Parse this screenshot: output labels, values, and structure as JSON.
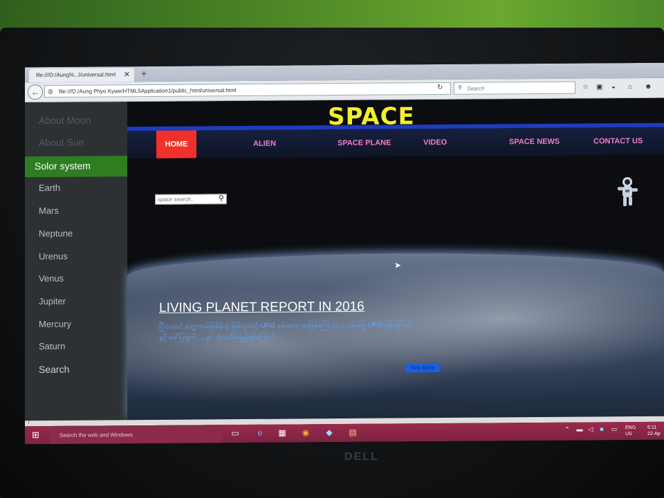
{
  "browser": {
    "tab_title": "file:///D:/Aung%...l/universal.html",
    "url": "file:///D:/Aung Phyo Kywe/HTML5Application1/public_html/universal.html",
    "search_placeholder": "Search"
  },
  "sidebar": {
    "items": [
      {
        "label": "About Moon"
      },
      {
        "label": "About Sun"
      },
      {
        "label": "Solor system"
      },
      {
        "label": "Earth"
      },
      {
        "label": "Mars"
      },
      {
        "label": "Neptune"
      },
      {
        "label": "Urenus"
      },
      {
        "label": "Venus"
      },
      {
        "label": "Jupiter"
      },
      {
        "label": "Mercury"
      },
      {
        "label": "Saturn"
      },
      {
        "label": "Search"
      }
    ]
  },
  "header": {
    "logo": "SPACE"
  },
  "menu": {
    "items": [
      {
        "label": "HOME"
      },
      {
        "label": "ALIEN"
      },
      {
        "label": "SPACE PLANE"
      },
      {
        "label": "VIDEO"
      },
      {
        "label": "SPACE NEWS"
      },
      {
        "label": "CONTACT US"
      }
    ],
    "active_color": "#f0302a"
  },
  "search": {
    "placeholder": "space search.."
  },
  "article": {
    "title": "LIVING PLANET REPORT IN 2016",
    "body": "ပြီးလသင် တွေ့ဘဝမ်ဖြစ်ခဲ့တဲ့ ဖြစ်သွားတဲ့ UFO ဖမ်းတော့ မှာဖြစ်ကြောင်း ... ၀မ်းမြေ့ UFO ဖြစ်ကြောင်း နှင့် ဖေါ်ပြချက် ... မှာ သုံးသပ်ကြည့်ရှုခဲ့ကြောင်း ...",
    "button": "See More"
  },
  "taskbar": {
    "search_placeholder": "Search the web and Windows",
    "tray_lang_1": "ENG",
    "tray_lang_2": "US",
    "clock_1": "5:11",
    "clock_2": "22-Ap"
  },
  "device": {
    "brand": "DELL"
  }
}
